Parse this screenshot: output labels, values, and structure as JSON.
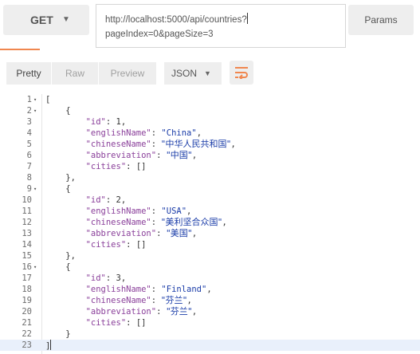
{
  "request": {
    "method": "GET",
    "url_line1": "http://localhost:5000/api/countries?",
    "url_line2": "pageIndex=0&pageSize=3",
    "params_label": "Params"
  },
  "response": {
    "tabs": [
      {
        "label": "Pretty",
        "active": true
      },
      {
        "label": "Raw",
        "active": false
      },
      {
        "label": "Preview",
        "active": false
      }
    ],
    "format": "JSON",
    "wrap_icon": "wrap-lines-icon"
  },
  "code_lines": [
    {
      "n": "1",
      "fold": true
    },
    {
      "n": "2",
      "fold": true
    },
    {
      "n": "3",
      "fold": false
    },
    {
      "n": "4",
      "fold": false
    },
    {
      "n": "5",
      "fold": false
    },
    {
      "n": "6",
      "fold": false
    },
    {
      "n": "7",
      "fold": false
    },
    {
      "n": "8",
      "fold": false
    },
    {
      "n": "9",
      "fold": true
    },
    {
      "n": "10",
      "fold": false
    },
    {
      "n": "11",
      "fold": false
    },
    {
      "n": "12",
      "fold": false
    },
    {
      "n": "13",
      "fold": false
    },
    {
      "n": "14",
      "fold": false
    },
    {
      "n": "15",
      "fold": false
    },
    {
      "n": "16",
      "fold": true
    },
    {
      "n": "17",
      "fold": false
    },
    {
      "n": "18",
      "fold": false
    },
    {
      "n": "19",
      "fold": false
    },
    {
      "n": "20",
      "fold": false
    },
    {
      "n": "21",
      "fold": false
    },
    {
      "n": "22",
      "fold": false
    },
    {
      "n": "23",
      "fold": false
    }
  ],
  "countries": [
    {
      "id": "1",
      "englishName": "\"China\"",
      "chineseName": "\"中华人民共和国\"",
      "abbreviation": "\"中国\""
    },
    {
      "id": "2",
      "englishName": "\"USA\"",
      "chineseName": "\"美利坚合众国\"",
      "abbreviation": "\"美国\""
    },
    {
      "id": "3",
      "englishName": "\"Finland\"",
      "chineseName": "\"芬兰\"",
      "abbreviation": "\"芬兰\""
    }
  ],
  "keys": {
    "id": "\"id\"",
    "englishName": "\"englishName\"",
    "chineseName": "\"chineseName\"",
    "abbreviation": "\"abbreviation\"",
    "cities": "\"cities\""
  },
  "syntax": {
    "open_bracket": "[",
    "close_bracket": "]",
    "open_brace": "{",
    "close_brace": "}",
    "close_brace_comma": "},",
    "colon": ": ",
    "comma": ",",
    "empty_array": "[]",
    "fold_marker": "▾"
  }
}
